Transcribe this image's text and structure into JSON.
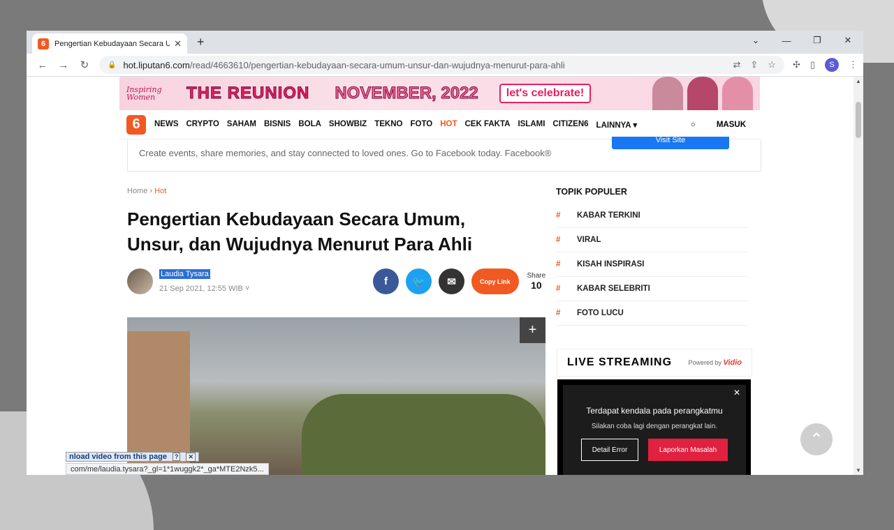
{
  "browser": {
    "tab_title": "Pengertian Kebudayaan Secara U",
    "url_domain": "hot.liputan6.com",
    "url_path": "/read/4663610/pengertian-kebudayaan-secara-umum-unsur-dan-wujudnya-menurut-para-ahli",
    "profile_initial": "S"
  },
  "banner": {
    "inspiring": "Inspiring Women",
    "reunion": "THE REUNION",
    "date": "NOVEMBER, 2022",
    "celebrate": "let's celebrate!"
  },
  "nav": {
    "logo": "6",
    "items": [
      "NEWS",
      "CRYPTO",
      "SAHAM",
      "BISNIS",
      "BOLA",
      "SHOWBIZ",
      "TEKNO",
      "FOTO",
      "HOT",
      "CEK FAKTA",
      "ISLAMI",
      "CITIZEN6",
      "LAINNYA ▾"
    ],
    "login": "MASUK"
  },
  "fb_ad": {
    "text": "Create events, share memories, and stay connected to loved ones. Go to Facebook today. Facebook®",
    "button": "Visit Site"
  },
  "breadcrumb": {
    "home": "Home",
    "sep": "›",
    "section": "Hot"
  },
  "article": {
    "title": "Pengertian Kebudayaan Secara Umum, Unsur, dan Wujudnya Menurut Para Ahli",
    "author": "Laudia Tysara",
    "date": "21 Sep 2021, 12:55 WIB ˅",
    "copy_link": "Copy Link",
    "share_label": "Share",
    "share_count": "10"
  },
  "sidebar": {
    "heading": "TOPIK POPULER",
    "items": [
      "KABAR TERKINI",
      "VIRAL",
      "KISAH INSPIRASI",
      "KABAR SELEBRITI",
      "FOTO LUCU"
    ]
  },
  "live": {
    "title": "LIVE STREAMING",
    "powered": "Powered by",
    "brand": "Vidio",
    "error_title": "Terdapat kendala pada perangkatmu",
    "error_sub": "Silakan coba lagi dengan perangkat lain.",
    "btn_detail": "Detail Error",
    "btn_report": "Laporkan Masalah"
  },
  "overlay": {
    "download_bar": "nload video from this page",
    "status_url": "com/me/laudia.tysara?_gl=1*1wuggk2*_ga*MTE2Nzk5..."
  },
  "colors": {
    "brand": "#f05a22",
    "facebook": "#3b5998",
    "twitter": "#1da1f2"
  }
}
